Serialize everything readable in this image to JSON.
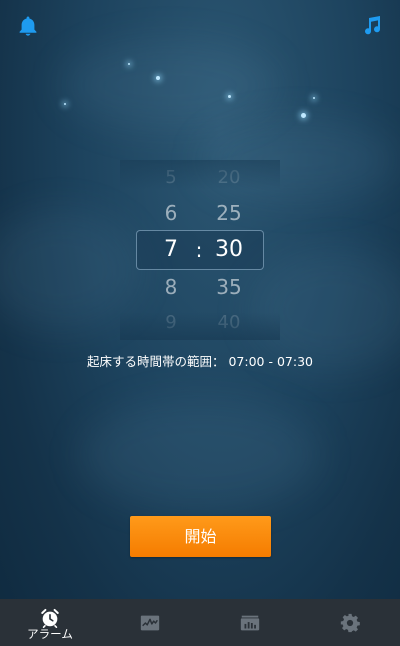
{
  "picker": {
    "hours": [
      "5",
      "6",
      "7",
      "8",
      "9"
    ],
    "minutes": [
      "20",
      "25",
      "30",
      "35",
      "40"
    ],
    "separator": ":"
  },
  "wake_range": {
    "label": "起床する時間帯の範囲：",
    "value": "07:00 - 07:30"
  },
  "start_button": {
    "label": "開始"
  },
  "bottom_nav": {
    "items": [
      {
        "icon": "alarm-clock-icon",
        "label": "アラーム",
        "active": true
      },
      {
        "icon": "sleep-graph-icon",
        "label": ""
      },
      {
        "icon": "statistics-icon",
        "label": ""
      },
      {
        "icon": "gear-icon",
        "label": ""
      }
    ]
  },
  "top_bar": {
    "left_icon": "bell-icon",
    "right_icon": "music-note-icon"
  },
  "colors": {
    "accent_blue": "#1e9bf0",
    "button_orange": "#f57c00",
    "nav_background": "#2a3138"
  }
}
